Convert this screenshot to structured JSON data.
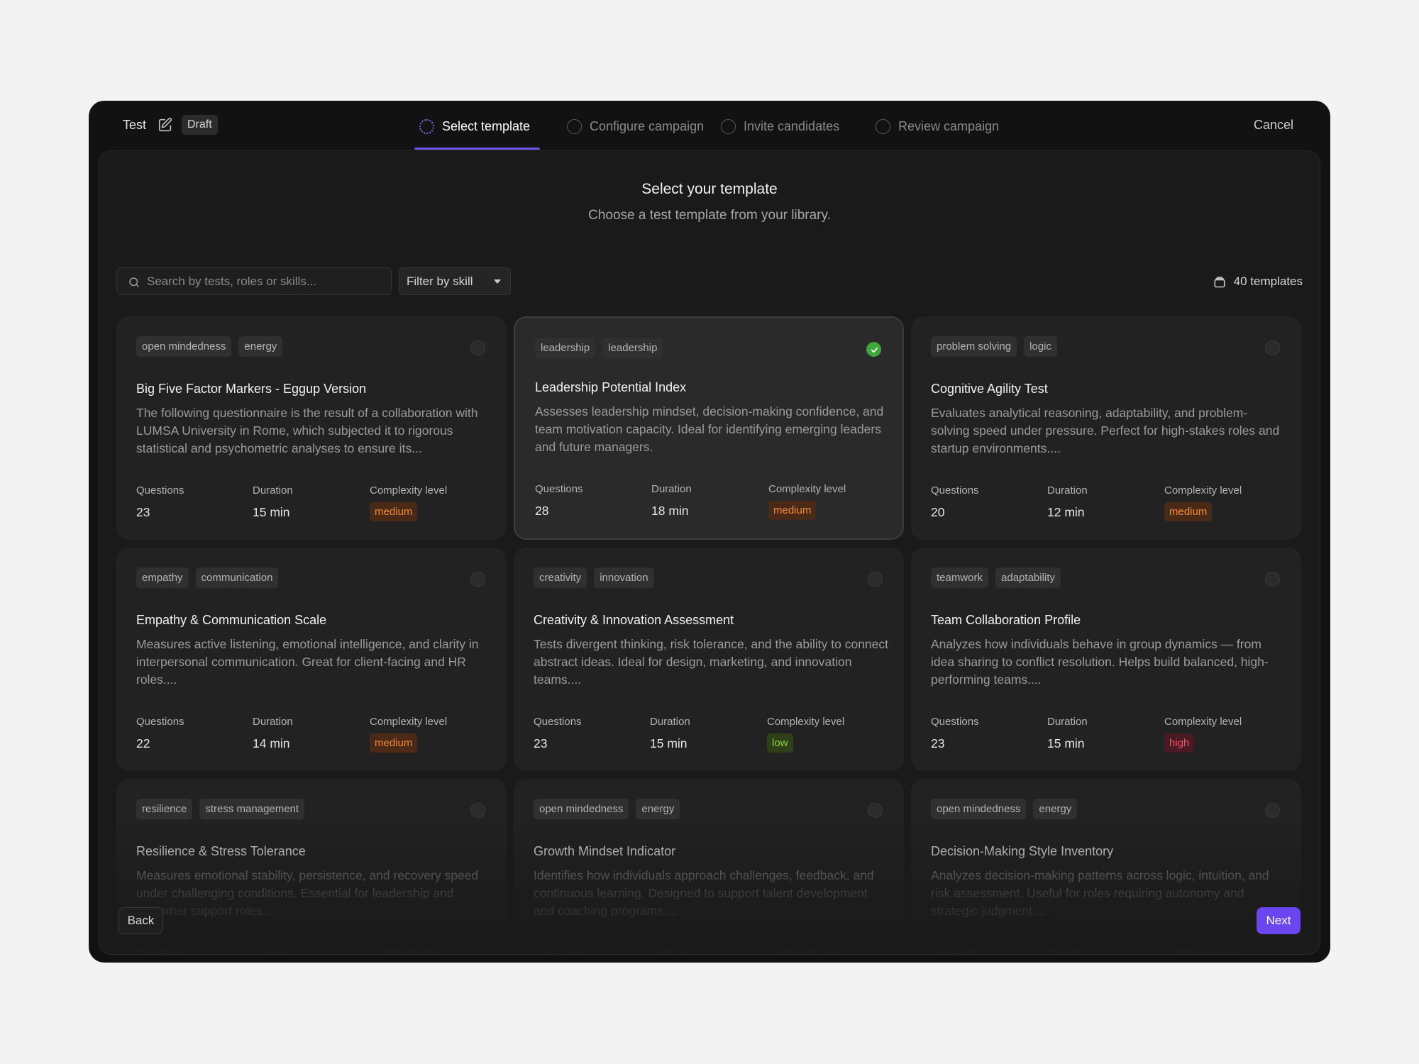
{
  "header": {
    "title": "Test",
    "status_badge": "Draft",
    "cancel_label": "Cancel",
    "steps": [
      {
        "label": "Select template",
        "active": true
      },
      {
        "label": "Configure campaign",
        "active": false
      },
      {
        "label": "Invite candidates",
        "active": false
      },
      {
        "label": "Review campaign",
        "active": false
      }
    ]
  },
  "main": {
    "title": "Select your template",
    "subtitle": "Choose a test template from your library.",
    "search_placeholder": "Search by tests, roles or skills...",
    "filter_label": "Filter by skill",
    "count_label": "40 templates"
  },
  "meta_labels": {
    "questions": "Questions",
    "duration": "Duration",
    "complexity": "Complexity level"
  },
  "cards": [
    {
      "tags": [
        "open mindedness",
        "energy"
      ],
      "title": "Big Five Factor Markers - Eggup Version",
      "description": "The following questionnaire is the result of a collaboration with LUMSA University in Rome, which subjected it to rigorous statistical and psychometric analyses to ensure its...",
      "questions": "23",
      "duration": "15 min",
      "complexity": "medium",
      "selected": false
    },
    {
      "tags": [
        "leadership",
        "leadership"
      ],
      "title": "Leadership Potential Index",
      "description": "Assesses leadership mindset, decision-making confidence, and team motivation capacity. Ideal for identifying emerging leaders and future managers.",
      "questions": "28",
      "duration": "18 min",
      "complexity": "medium",
      "selected": true
    },
    {
      "tags": [
        "problem solving",
        "logic"
      ],
      "title": "Cognitive Agility Test",
      "description": "Evaluates analytical reasoning, adaptability, and problem-solving speed under pressure. Perfect for high-stakes roles and startup environments....",
      "questions": "20",
      "duration": "12 min",
      "complexity": "medium",
      "selected": false
    },
    {
      "tags": [
        "empathy",
        "communication"
      ],
      "title": "Empathy & Communication Scale",
      "description": "Measures active listening, emotional intelligence, and clarity in interpersonal communication. Great for client-facing and HR roles....",
      "questions": "22",
      "duration": "14 min",
      "complexity": "medium",
      "selected": false
    },
    {
      "tags": [
        "creativity",
        "innovation"
      ],
      "title": "Creativity & Innovation Assessment",
      "description": "Tests divergent thinking, risk tolerance, and the ability to connect abstract ideas. Ideal for design, marketing, and innovation teams....",
      "questions": "23",
      "duration": "15 min",
      "complexity": "low",
      "selected": false
    },
    {
      "tags": [
        "teamwork",
        "adaptability"
      ],
      "title": "Team Collaboration Profile",
      "description": "Analyzes how individuals behave in group dynamics — from idea sharing to conflict resolution. Helps build balanced, high-performing teams....",
      "questions": "23",
      "duration": "15 min",
      "complexity": "high",
      "selected": false
    },
    {
      "tags": [
        "resilience",
        "stress management"
      ],
      "title": "Resilience & Stress Tolerance",
      "description": "Measures emotional stability, persistence, and recovery speed under challenging conditions. Essential for leadership and customer support roles....",
      "questions": "",
      "duration": "",
      "complexity": "",
      "selected": false
    },
    {
      "tags": [
        "open mindedness",
        "energy"
      ],
      "title": "Growth Mindset Indicator",
      "description": "Identifies how individuals approach challenges, feedback, and continuous learning. Designed to support talent development and coaching programs....",
      "questions": "",
      "duration": "",
      "complexity": "",
      "selected": false
    },
    {
      "tags": [
        "open mindedness",
        "energy"
      ],
      "title": "Decision-Making Style Inventory",
      "description": "Analyzes decision-making patterns across logic, intuition, and risk assessment. Useful for roles requiring autonomy and strategic judgment....",
      "questions": "",
      "duration": "",
      "complexity": "",
      "selected": false
    }
  ],
  "footer": {
    "back_label": "Back",
    "next_label": "Next"
  },
  "colors": {
    "accent": "#6b46ee",
    "selected_check": "#3ea83a",
    "medium": "#f08a3c",
    "low": "#8bd23e",
    "high": "#f0506b"
  }
}
